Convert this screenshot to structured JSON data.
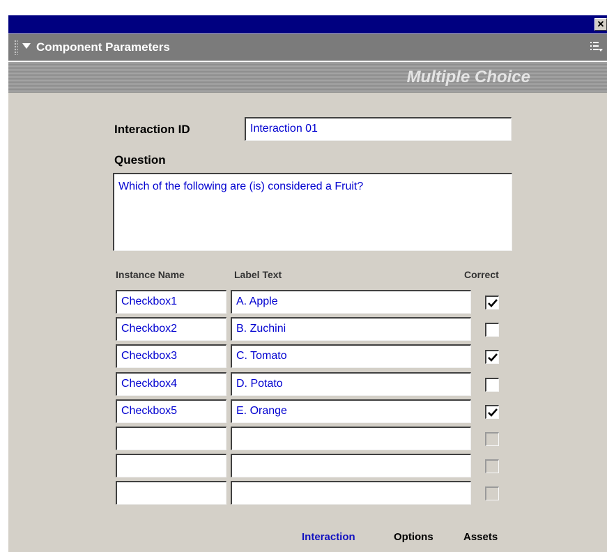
{
  "window": {
    "close_symbol": "✕",
    "icons": [
      "close-icon",
      "collapse-arrow-icon",
      "panel-menu-icon",
      "drag-grip-icon",
      "checkmark-icon"
    ]
  },
  "panel": {
    "title": "Component Parameters"
  },
  "header": {
    "title": "Multiple Choice"
  },
  "form": {
    "interaction_id_label": "Interaction ID",
    "interaction_id_value": "Interaction  01",
    "question_label": "Question",
    "question_value": "Which of the following are (is) considered a Fruit?"
  },
  "table": {
    "headers": [
      "Instance Name",
      "Label Text",
      "Correct"
    ],
    "rows": [
      {
        "instance": "Checkbox1",
        "label": "A.  Apple",
        "correct": true,
        "enabled": true
      },
      {
        "instance": "Checkbox2",
        "label": "B.  Zuchini",
        "correct": false,
        "enabled": true
      },
      {
        "instance": "Checkbox3",
        "label": "C.  Tomato",
        "correct": true,
        "enabled": true
      },
      {
        "instance": "Checkbox4",
        "label": "D.  Potato",
        "correct": false,
        "enabled": true
      },
      {
        "instance": "Checkbox5",
        "label": "E.  Orange",
        "correct": true,
        "enabled": true
      },
      {
        "instance": "",
        "label": "",
        "correct": false,
        "enabled": false
      },
      {
        "instance": "",
        "label": "",
        "correct": false,
        "enabled": false
      },
      {
        "instance": "",
        "label": "",
        "correct": false,
        "enabled": false
      }
    ]
  },
  "footer": {
    "tabs": [
      {
        "label": "Interaction",
        "active": true
      },
      {
        "label": "Options",
        "active": false
      },
      {
        "label": "Assets",
        "active": false
      }
    ]
  },
  "colors": {
    "titlebar": "#000080",
    "panel_bg": "#d4d0c8",
    "field_text": "#0000d0",
    "active_tab": "#1010c0"
  }
}
